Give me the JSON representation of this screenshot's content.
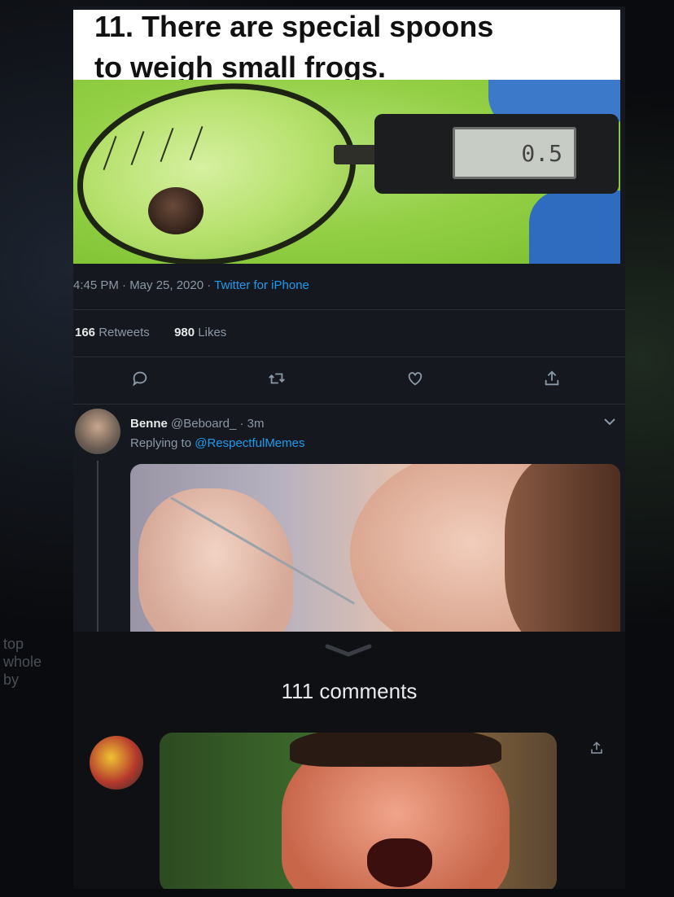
{
  "meme": {
    "title_line1": "11. There are special spoons",
    "title_line2": "to weigh small frogs.",
    "scale_reading": "0.5"
  },
  "tweet": {
    "time": "4:45 PM · May 25, 2020 · ",
    "client": "Twitter for iPhone",
    "retweets_count": "166",
    "retweets_label": "Retweets",
    "likes_count": "980",
    "likes_label": "Likes"
  },
  "actions": {
    "reply_icon": "reply-icon",
    "retweet_icon": "retweet-icon",
    "like_icon": "heart-icon",
    "share_icon": "share-icon"
  },
  "reply": {
    "name": "Benne",
    "handle": "@Beboard_ · 3m",
    "replying_prefix": "Replying to ",
    "replying_handle": "@RespectfulMemes"
  },
  "comments": {
    "count_label": "111 comments"
  },
  "side_text": [
    "top",
    "whole",
    "by"
  ],
  "colors": {
    "link": "#1d9bf0",
    "muted": "#8b98a5",
    "background": "#15181e"
  }
}
